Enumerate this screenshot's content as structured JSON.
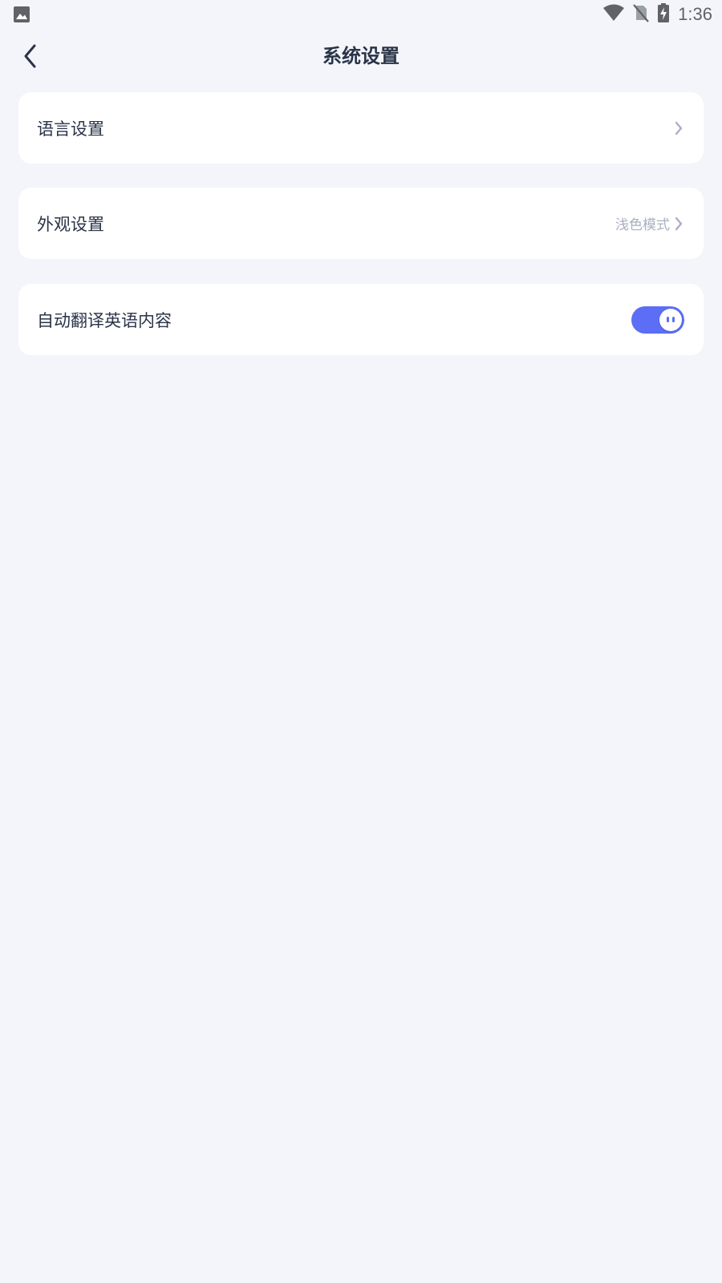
{
  "status_bar": {
    "time": "1:36",
    "icons": [
      "image-icon",
      "wifi-icon",
      "no-sim-icon",
      "battery-charging-icon"
    ]
  },
  "header": {
    "title": "系统设置",
    "back_icon": "chevron-left-icon"
  },
  "settings": {
    "language": {
      "label": "语言设置"
    },
    "appearance": {
      "label": "外观设置",
      "value": "浅色模式"
    },
    "auto_translate": {
      "label": "自动翻译英语内容",
      "enabled": true
    }
  },
  "colors": {
    "background": "#F4F5FA",
    "card": "#FFFFFF",
    "text_primary": "#2A3448",
    "text_secondary": "#A8B0C0",
    "accent": "#5B6EF5",
    "status_icons": "#5F6368"
  }
}
